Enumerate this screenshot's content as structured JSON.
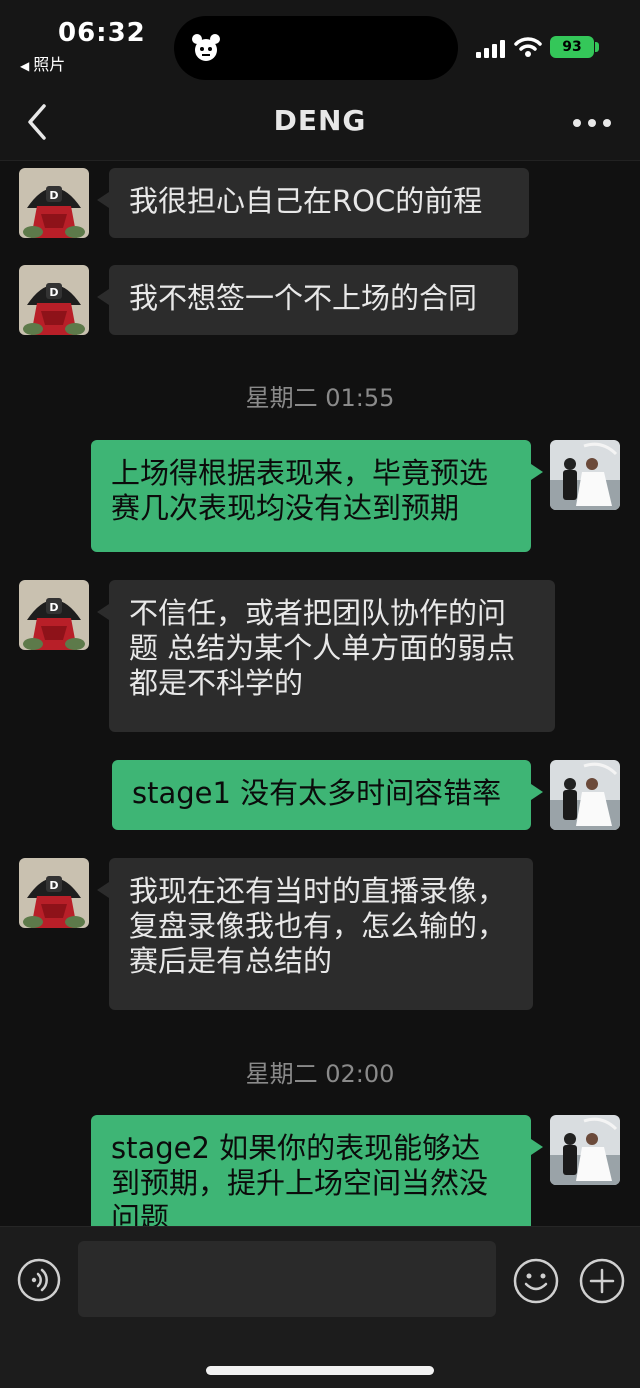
{
  "status_bar": {
    "time": "06:32",
    "back_app": "照片",
    "battery": "93",
    "icons": [
      "cellular-signal-icon",
      "wifi-icon",
      "battery-icon"
    ]
  },
  "nav": {
    "title": "DENG",
    "back_icon": "chevron-left-icon",
    "more_icon": "more-dots-icon"
  },
  "colors": {
    "incoming_bubble": "#2c2c2c",
    "outgoing_bubble": "#3eb575",
    "background": "#111111"
  },
  "messages": [
    {
      "from": "contact",
      "text": "我很担心自己在ROC的前程"
    },
    {
      "from": "contact",
      "text": "我不想签一个不上场的合同"
    },
    {
      "timestamp": "星期二 01:55"
    },
    {
      "from": "me",
      "lines": [
        "上场得根据表现来，毕竟预选",
        "赛几次表现均没有达到预期"
      ]
    },
    {
      "from": "contact",
      "lines": [
        "不信任，或者把团队协作的问",
        "题 总结为某个人单方面的弱点",
        "都是不科学的"
      ]
    },
    {
      "from": "me",
      "text": "stage1 没有太多时间容错率"
    },
    {
      "from": "contact",
      "lines": [
        "我现在还有当时的直播录像，",
        "复盘录像我也有，怎么输的，",
        "赛后是有总结的"
      ]
    },
    {
      "timestamp": "星期二 02:00"
    },
    {
      "from": "me",
      "lines": [
        "stage2 如果你的表现能够达",
        "到预期，提升上场空间当然没",
        "问题"
      ]
    }
  ],
  "input_bar": {
    "placeholder": "",
    "icons": [
      "voice-icon",
      "emoji-icon",
      "plus-icon"
    ]
  }
}
